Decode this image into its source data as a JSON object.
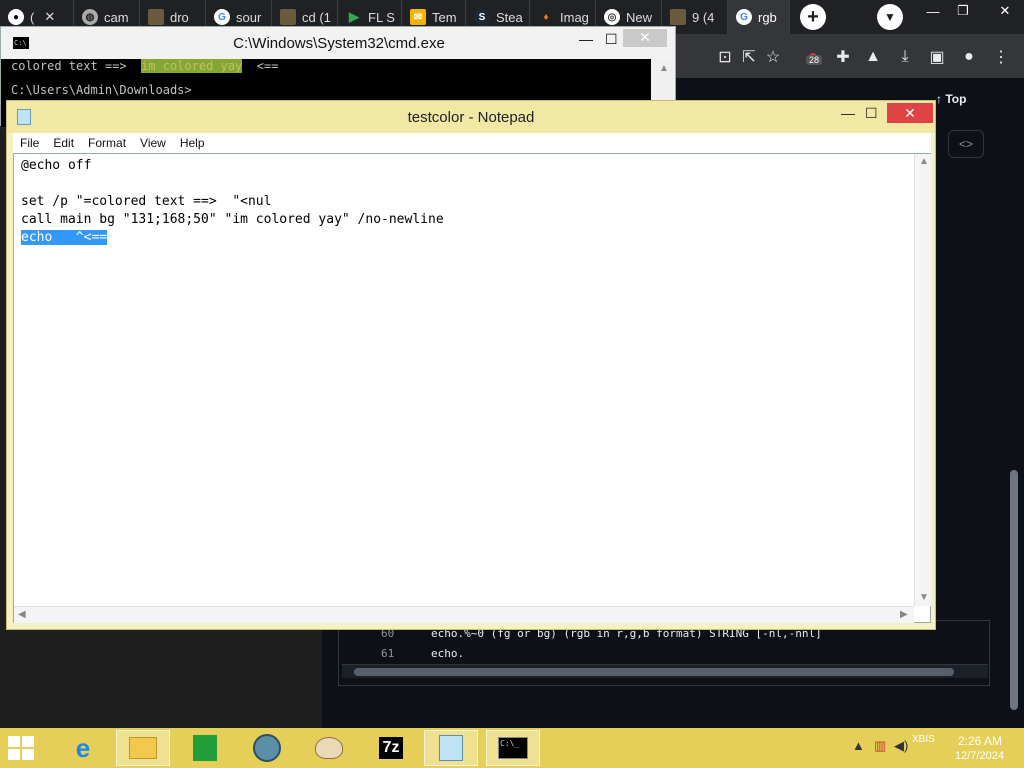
{
  "chrome": {
    "tabs": [
      {
        "label": "(",
        "icon": "github-icon"
      },
      {
        "label": "cam",
        "icon": "globe-icon"
      },
      {
        "label": "dro",
        "icon": "folder-icon"
      },
      {
        "label": "sour",
        "icon": "google-icon"
      },
      {
        "label": "cd (1",
        "icon": "folder-icon"
      },
      {
        "label": "FL S",
        "icon": "play-store-icon"
      },
      {
        "label": "Tem",
        "icon": "mail-icon"
      },
      {
        "label": "Stea",
        "icon": "steam-icon"
      },
      {
        "label": "Imag",
        "icon": "flame-icon"
      },
      {
        "label": "New",
        "icon": "chrome-icon"
      },
      {
        "label": "9 (4",
        "icon": "folder-icon"
      },
      {
        "label": "rgb",
        "icon": "google-icon",
        "active": true
      }
    ],
    "extension_badge": "28",
    "top_link": "Top"
  },
  "cmd": {
    "title": "C:\\Windows\\System32\\cmd.exe",
    "line1_prefix": "colored text ==>  ",
    "line1_colored": "im colored yay",
    "line1_suffix": "  <==",
    "line2": "C:\\Users\\Admin\\Downloads>"
  },
  "notepad": {
    "title": "testcolor - Notepad",
    "menu": [
      "File",
      "Edit",
      "Format",
      "View",
      "Help"
    ],
    "lines": [
      "@echo off",
      "",
      "set /p \"=colored text ==>  \"<nul",
      "call main bg \"131;168;50\" \"im colored yay\" /no-newline"
    ],
    "selected_line": "echo   ^<=="
  },
  "code_view": {
    "lines": [
      {
        "num": "60",
        "text": "echo.%~0 (fg or bg) (rgb in  r,g,b  format)  STRING  [-nl,-nnl]"
      },
      {
        "num": "61",
        "text": "echo."
      }
    ]
  },
  "taskbar": {
    "clock_time": "2:26 AM",
    "clock_date": "12/7/2024",
    "tray_label": "XBIS"
  }
}
